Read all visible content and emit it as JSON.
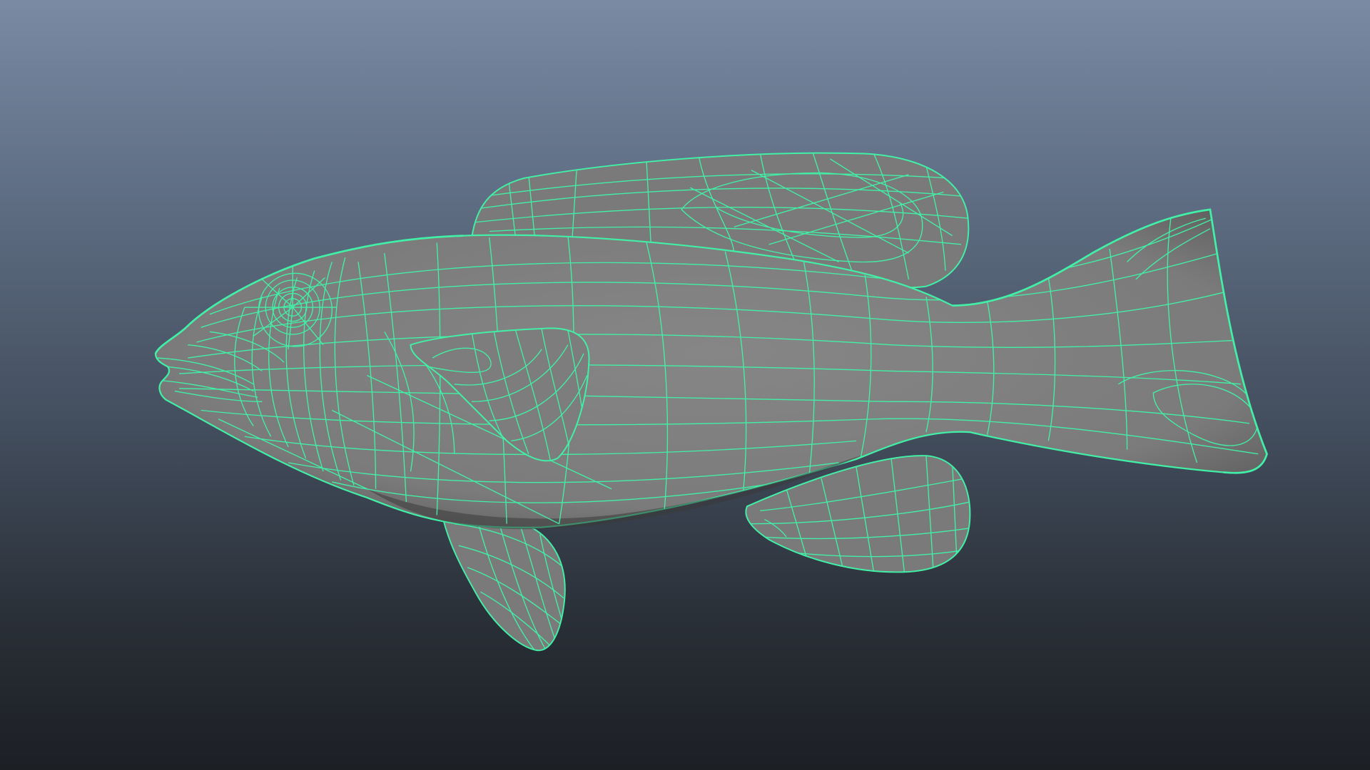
{
  "viewport": {
    "label": "",
    "wire_color": "#41f0a6",
    "surface_color": "#7c7c7c",
    "background_top": "#7a8aa3",
    "background_bottom": "#1c1f24"
  },
  "model": {
    "name": "",
    "display_mode": "wireframe-on-shaded"
  }
}
